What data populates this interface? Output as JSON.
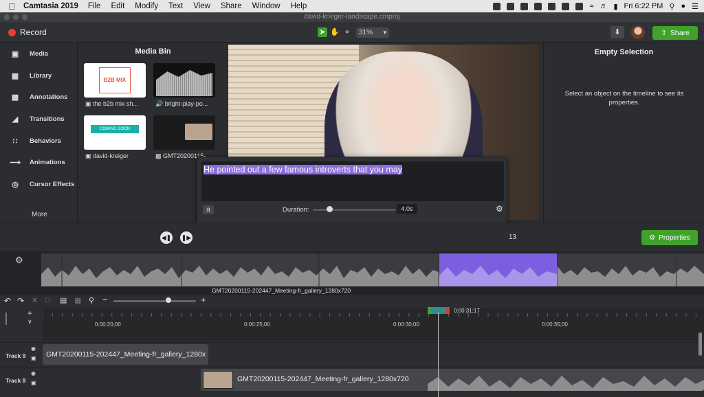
{
  "menubar": {
    "app": "Camtasia 2019",
    "items": [
      "File",
      "Edit",
      "Modify",
      "Text",
      "View",
      "Share",
      "Window",
      "Help"
    ],
    "clock": "Fri 6:22 PM"
  },
  "window": {
    "title": "david-krieger-landscape.cmproj"
  },
  "toolbar": {
    "record": "Record",
    "zoom": "31%",
    "share": "Share"
  },
  "nav": {
    "items": [
      "Media",
      "Library",
      "Annotations",
      "Transitions",
      "Behaviors",
      "Animations",
      "Cursor Effects"
    ],
    "more": "More"
  },
  "mediabin": {
    "title": "Media Bin",
    "items": [
      {
        "label": "the b2b mix sh...",
        "thumb_text": "B2B MIX"
      },
      {
        "label": "bright-play-po...",
        "thumb_text": ""
      },
      {
        "label": "david-kreiger",
        "thumb_text": "COMING SOON"
      },
      {
        "label": "GMT20200115-...",
        "thumb_text": ""
      }
    ]
  },
  "properties": {
    "title": "Empty Selection",
    "message": "Select an object on the timeline to see its properties.",
    "button": "Properties"
  },
  "caption": {
    "text": "He pointed out a few famous introverts that you may",
    "font_button": "a",
    "duration_label": "Duration:",
    "duration_value": "4.0s",
    "duration_fraction": 0.2
  },
  "playback": {
    "frame": "13"
  },
  "strip": {
    "label": "GMT20200115-202447_Meeting-fr_gallery_1280x720"
  },
  "ruler": {
    "ticks": [
      "0:00:20;00",
      "0:00:25;00",
      "0:00:30;00",
      "0:00:35;00"
    ],
    "playhead": "0:00:31;17"
  },
  "tracks": [
    {
      "name": "Track 9",
      "clip": "GMT20200115-202447_Meeting-fr_gallery_1280x"
    },
    {
      "name": "Track 8",
      "clip": "GMT20200115-202447_Meeting-fr_gallery_1280x720"
    }
  ],
  "colors": {
    "accent_green": "#3fa32b",
    "selection_purple": "#7d5ee0",
    "caption_highlight": "#8b6bd8",
    "record_red": "#e8412d"
  }
}
